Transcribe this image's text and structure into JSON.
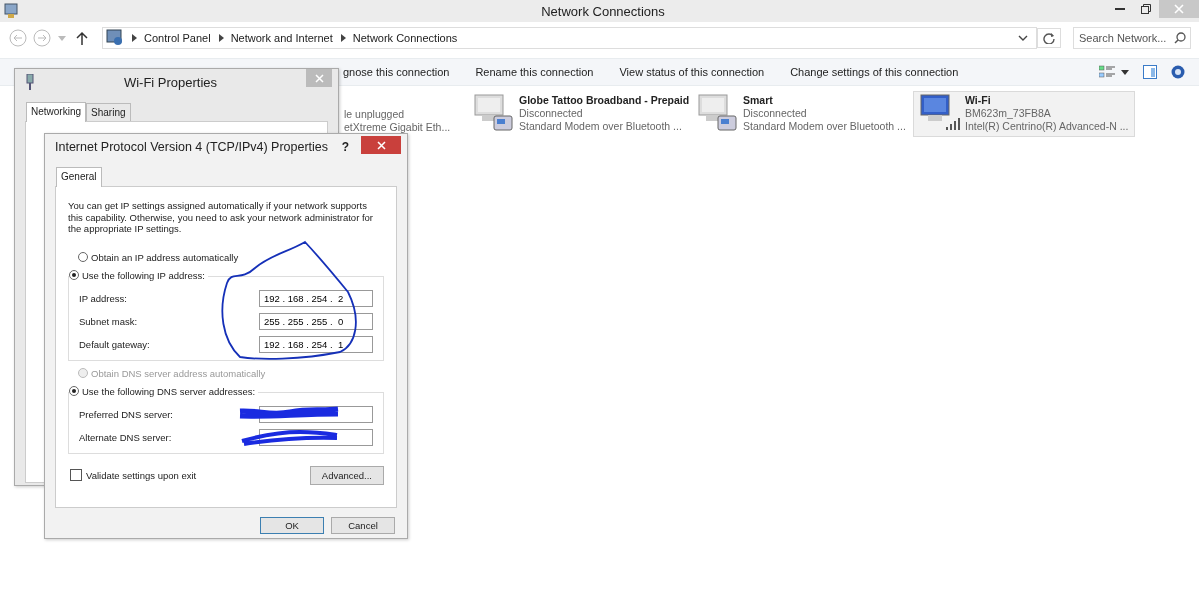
{
  "window": {
    "title": "Network Connections"
  },
  "address_bar": {
    "crumbs": [
      "Control Panel",
      "Network and Internet",
      "Network Connections"
    ]
  },
  "search": {
    "placeholder": "Search Network..."
  },
  "toolbar": {
    "commands": [
      "gnose this connection",
      "Rename this connection",
      "View status of this connection",
      "Change settings of this connection"
    ]
  },
  "connections": [
    {
      "kind": "ethernet",
      "status": "le unplugged",
      "device": "etXtreme Gigabit Eth...",
      "selected": false
    },
    {
      "kind": "modem",
      "name": "Globe Tattoo Broadband - Prepaid",
      "status": "Disconnected",
      "device": "Standard Modem over Bluetooth ...",
      "selected": false
    },
    {
      "kind": "modem",
      "name": "Smart",
      "status": "Disconnected",
      "device": "Standard Modem over Bluetooth ...",
      "selected": false
    },
    {
      "kind": "wifi",
      "name": "Wi-Fi",
      "status": "BM623m_73FB8A",
      "device": "Intel(R) Centrino(R) Advanced-N ...",
      "selected": true
    }
  ],
  "wifi_dialog": {
    "title": "Wi-Fi Properties",
    "tabs": [
      {
        "label": "Networking",
        "selected": true
      },
      {
        "label": "Sharing",
        "selected": false
      }
    ]
  },
  "ipv4_dialog": {
    "title": "Internet Protocol Version 4 (TCP/IPv4) Properties",
    "help": "?",
    "tabs": [
      {
        "label": "General",
        "selected": true
      }
    ],
    "intro": "You can get IP settings assigned automatically if your network supports this capability. Otherwise, you need to ask your network administrator for the appropriate IP settings.",
    "ip_mode": [
      {
        "label": "Obtain an IP address automatically",
        "selected": false,
        "disabled": false
      },
      {
        "label": "Use the following IP address:",
        "selected": true,
        "disabled": false
      }
    ],
    "ip_fields": [
      {
        "label": "IP address:",
        "value": "192 . 168 . 254 .  2"
      },
      {
        "label": "Subnet mask:",
        "value": "255 . 255 . 255 .  0"
      },
      {
        "label": "Default gateway:",
        "value": "192 . 168 . 254 .  1"
      }
    ],
    "dns_mode": [
      {
        "label": "Obtain DNS server address automatically",
        "selected": false,
        "disabled": true
      },
      {
        "label": "Use the following DNS server addresses:",
        "selected": true,
        "disabled": false
      }
    ],
    "dns_fields": [
      {
        "label": "Preferred DNS server:"
      },
      {
        "label": "Alternate DNS server:"
      }
    ],
    "validate": {
      "label": "Validate settings upon exit",
      "checked": false
    },
    "advanced": "Advanced...",
    "buttons": [
      {
        "label": "OK",
        "default": true
      },
      {
        "label": "Cancel",
        "default": false
      }
    ]
  }
}
